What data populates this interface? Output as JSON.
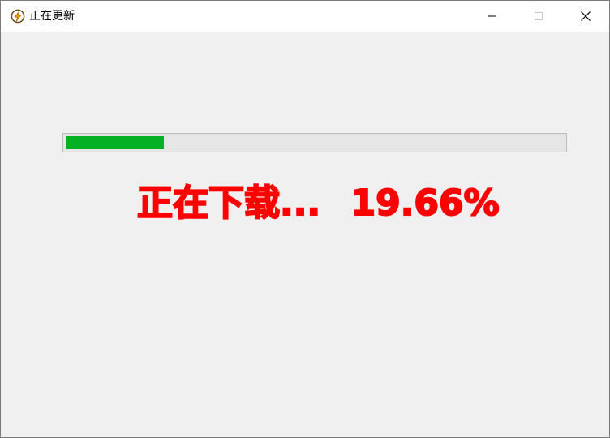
{
  "window": {
    "title": "正在更新",
    "controls": {
      "minimize_icon": "minimize-icon",
      "maximize_icon": "maximize-icon",
      "close_icon": "close-icon"
    }
  },
  "app_icon": {
    "name": "lightning-bolt-icon"
  },
  "progress": {
    "value_percent": 19.66,
    "fill_color": "#06b025",
    "track_color": "#e6e6e6"
  },
  "status": {
    "label": "正在下载...",
    "percent_text": "19.66%",
    "color": "#ff0000"
  }
}
